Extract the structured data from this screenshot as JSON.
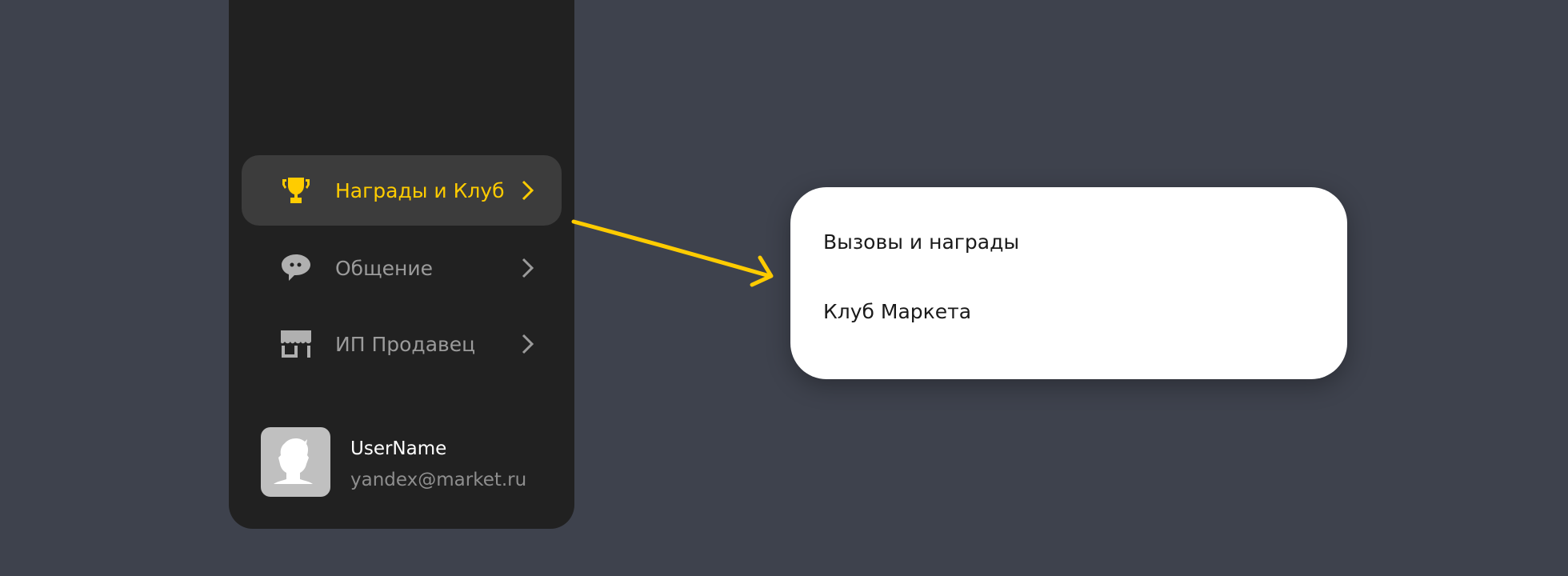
{
  "sidebar": {
    "items": [
      {
        "label": "Награды и Клуб",
        "icon": "trophy-icon",
        "active": true
      },
      {
        "label": "Общение",
        "icon": "chat-bubble-icon",
        "active": false
      },
      {
        "label": "ИП Продавец",
        "icon": "storefront-icon",
        "active": false
      }
    ],
    "user": {
      "name": "UserName",
      "email": "yandex@market.ru"
    }
  },
  "submenu": {
    "items": [
      {
        "label": "Вызовы и награды"
      },
      {
        "label": "Клуб Маркета"
      }
    ]
  },
  "colors": {
    "accent": "#ffcc00",
    "background": "#3e424d",
    "sidebar": "#212121"
  }
}
